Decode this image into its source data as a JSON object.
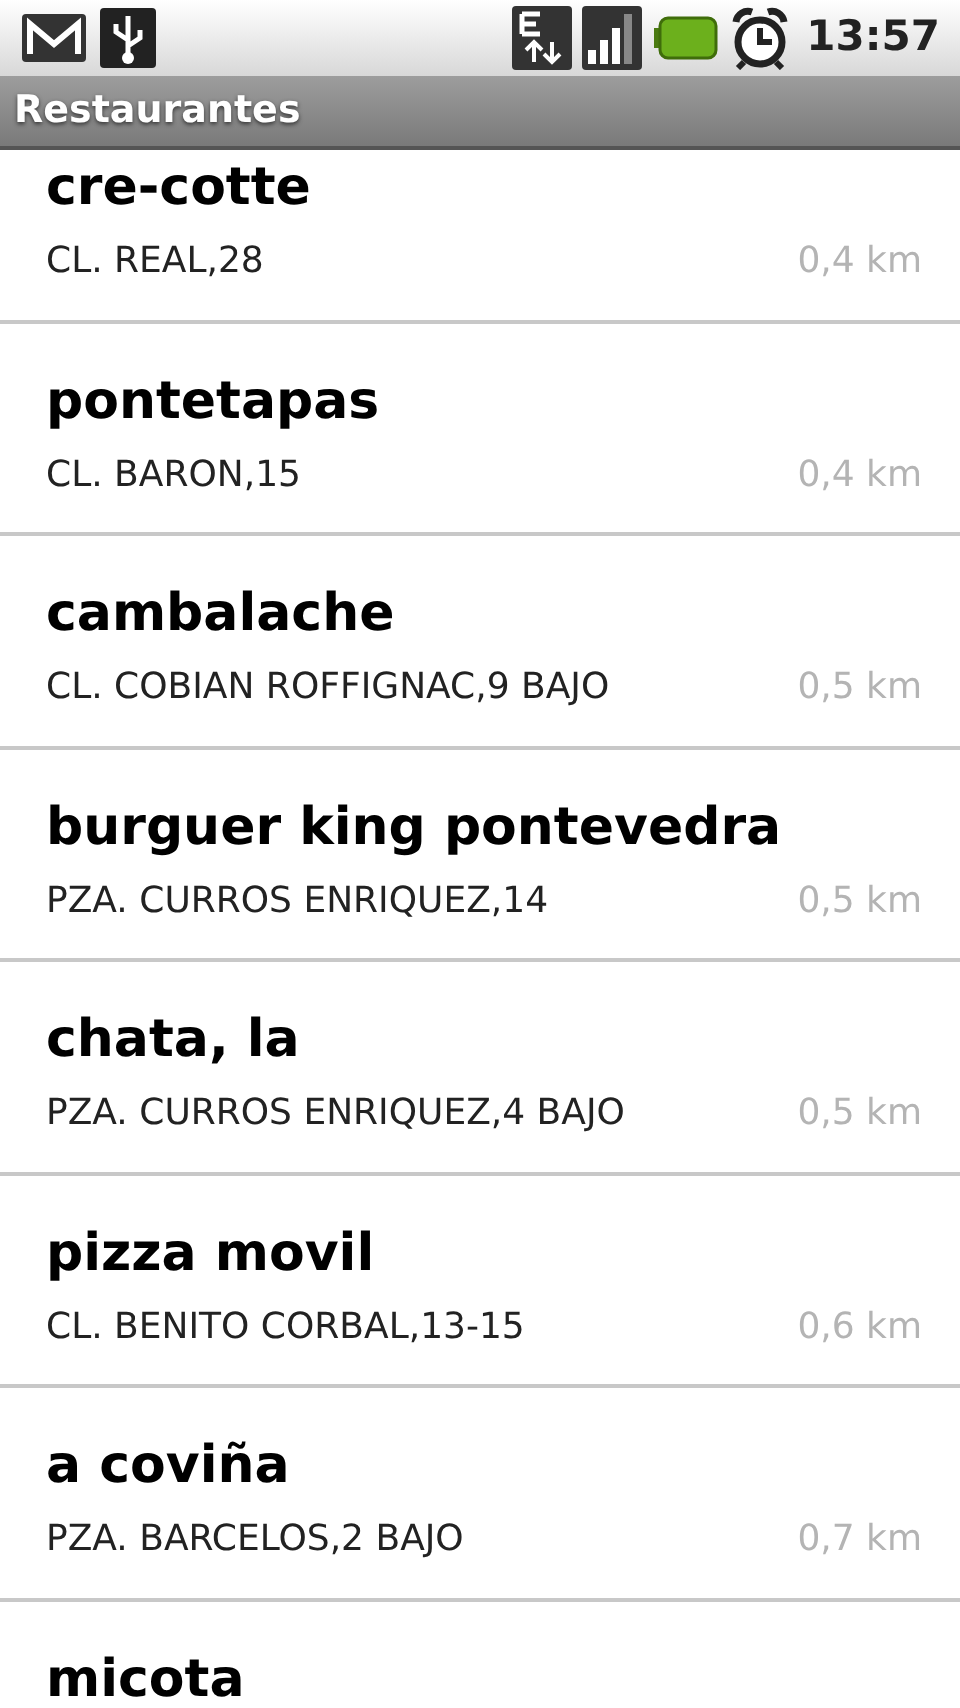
{
  "status_bar": {
    "time": "13:57"
  },
  "title_bar": {
    "title": "Restaurantes"
  },
  "restaurants": [
    {
      "name": "cre-cotte",
      "address": "CL. REAL,28",
      "distance": "0,4 km"
    },
    {
      "name": "pontetapas",
      "address": "CL. BARON,15",
      "distance": "0,4 km"
    },
    {
      "name": "cambalache",
      "address": "CL. COBIAN ROFFIGNAC,9 BAJO",
      "distance": "0,5 km"
    },
    {
      "name": "burguer king pontevedra",
      "address": "PZA. CURROS ENRIQUEZ,14",
      "distance": "0,5 km"
    },
    {
      "name": "chata, la",
      "address": "PZA. CURROS ENRIQUEZ,4 BAJO",
      "distance": "0,5 km"
    },
    {
      "name": "pizza movil",
      "address": "CL. BENITO CORBAL,13-15",
      "distance": "0,6 km"
    },
    {
      "name": "a coviña",
      "address": "PZA. BARCELOS,2 BAJO",
      "distance": "0,7 km"
    },
    {
      "name": "micota"
    }
  ]
}
